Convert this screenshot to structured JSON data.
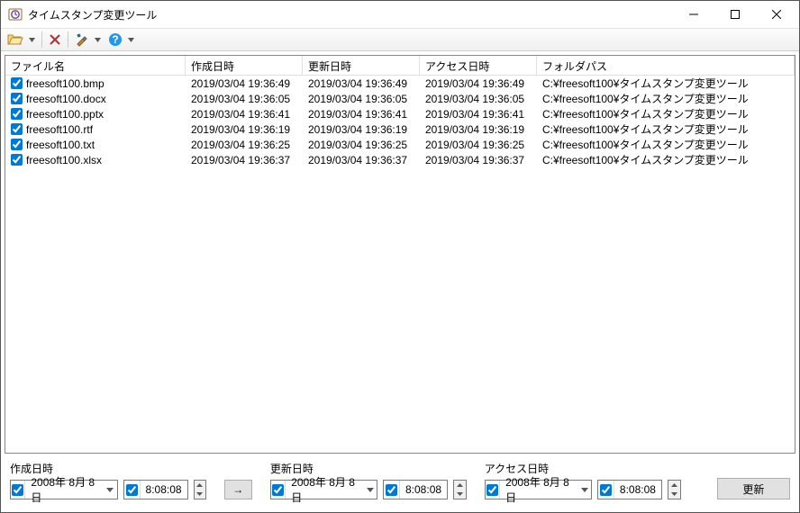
{
  "window": {
    "title": "タイムスタンプ変更ツール"
  },
  "toolbar": {
    "open": "開く",
    "delete": "削除",
    "settings": "設定",
    "help": "ヘルプ"
  },
  "columns": {
    "name": "ファイル名",
    "created": "作成日時",
    "modified": "更新日時",
    "accessed": "アクセス日時",
    "folder": "フォルダパス"
  },
  "files": [
    {
      "checked": true,
      "name": "freesoft100.bmp",
      "created": "2019/03/04 19:36:49",
      "modified": "2019/03/04 19:36:49",
      "accessed": "2019/03/04 19:36:49",
      "folder": "C:¥freesoft100¥タイムスタンプ変更ツール"
    },
    {
      "checked": true,
      "name": "freesoft100.docx",
      "created": "2019/03/04 19:36:05",
      "modified": "2019/03/04 19:36:05",
      "accessed": "2019/03/04 19:36:05",
      "folder": "C:¥freesoft100¥タイムスタンプ変更ツール"
    },
    {
      "checked": true,
      "name": "freesoft100.pptx",
      "created": "2019/03/04 19:36:41",
      "modified": "2019/03/04 19:36:41",
      "accessed": "2019/03/04 19:36:41",
      "folder": "C:¥freesoft100¥タイムスタンプ変更ツール"
    },
    {
      "checked": true,
      "name": "freesoft100.rtf",
      "created": "2019/03/04 19:36:19",
      "modified": "2019/03/04 19:36:19",
      "accessed": "2019/03/04 19:36:19",
      "folder": "C:¥freesoft100¥タイムスタンプ変更ツール"
    },
    {
      "checked": true,
      "name": "freesoft100.txt",
      "created": "2019/03/04 19:36:25",
      "modified": "2019/03/04 19:36:25",
      "accessed": "2019/03/04 19:36:25",
      "folder": "C:¥freesoft100¥タイムスタンプ変更ツール"
    },
    {
      "checked": true,
      "name": "freesoft100.xlsx",
      "created": "2019/03/04 19:36:37",
      "modified": "2019/03/04 19:36:37",
      "accessed": "2019/03/04 19:36:37",
      "folder": "C:¥freesoft100¥タイムスタンプ変更ツール"
    }
  ],
  "edit": {
    "created": {
      "label": "作成日時",
      "date": "2008年 8月 8日",
      "time": "8:08:08"
    },
    "modified": {
      "label": "更新日時",
      "date": "2008年 8月 8日",
      "time": "8:08:08"
    },
    "accessed": {
      "label": "アクセス日時",
      "date": "2008年 8月 8日",
      "time": "8:08:08"
    },
    "apply_arrow": "→",
    "update": "更新"
  }
}
